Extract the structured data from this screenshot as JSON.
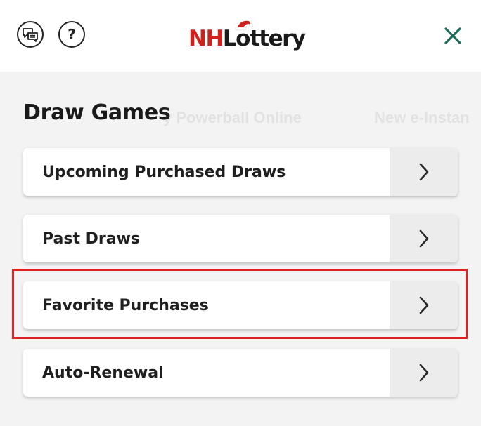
{
  "header": {
    "logo": {
      "part1": "NH",
      "part2": "Lo",
      "part3": "ttery"
    },
    "help_glyph": "?",
    "icons": {
      "chat": "chat-bubbles-icon",
      "help": "question-mark-icon",
      "close": "close-x-icon",
      "logo_hat": "santa-hat-icon"
    }
  },
  "background": {
    "ghost_text_1": "y Powerball Online",
    "ghost_text_2": "New e-Instan"
  },
  "section": {
    "title": "Draw Games"
  },
  "menu": {
    "items": [
      {
        "label": "Upcoming Purchased Draws"
      },
      {
        "label": "Past Draws"
      },
      {
        "label": "Favorite Purchases",
        "highlighted": true
      },
      {
        "label": "Auto-Renewal"
      }
    ]
  },
  "colors": {
    "brand_red": "#d0221d",
    "close_green": "#1f6b5c",
    "highlight_red": "#e02020",
    "arrow_panel": "#ececec"
  }
}
